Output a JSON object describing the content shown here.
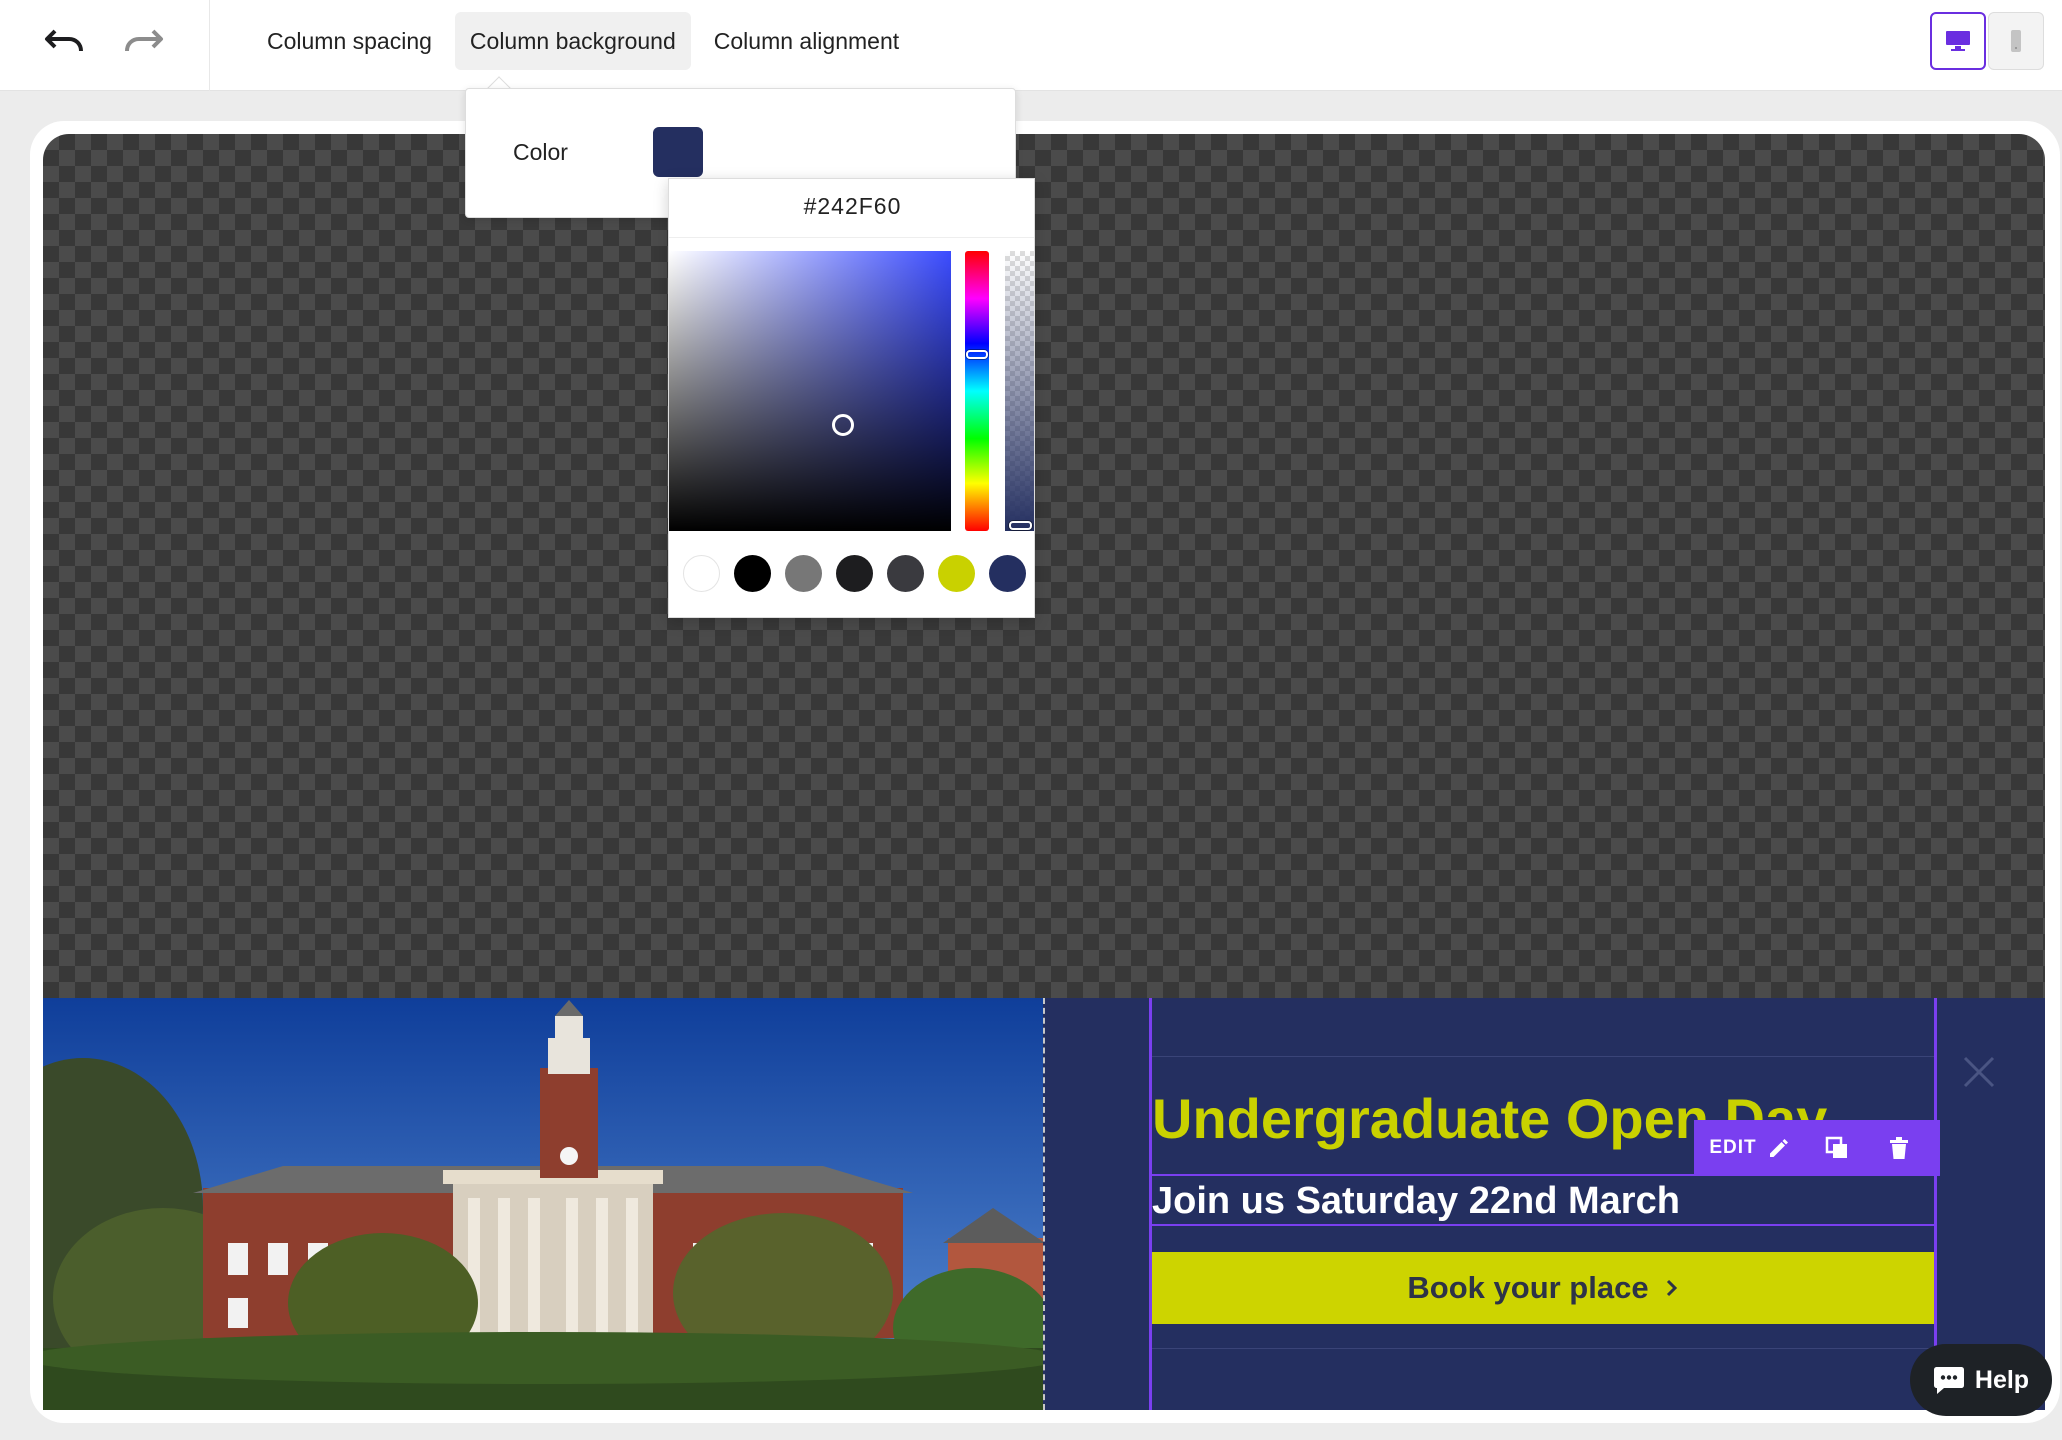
{
  "toolbar": {
    "tabs": [
      {
        "label": "Column spacing"
      },
      {
        "label": "Column background"
      },
      {
        "label": "Column alignment"
      }
    ],
    "active_tab": "Column background",
    "device_active": "desktop"
  },
  "color_popover": {
    "label": "Color",
    "current_color": "#242F60"
  },
  "color_picker": {
    "hex_value": "#242F60",
    "presets": [
      "#ffffff",
      "#000000",
      "#777777",
      "#1d1d1f",
      "#3a3a3f",
      "#c9d100",
      "#242f60"
    ]
  },
  "hero": {
    "heading": "Undergraduate Open Day",
    "subheading": "Join us Saturday 22nd March",
    "cta_label": "Book your place",
    "edit_label": "EDIT"
  },
  "colors": {
    "accent": "#7a3ff0",
    "hero_bg": "#242f60",
    "brand_lime": "#c9d100"
  },
  "help": {
    "label": "Help"
  }
}
